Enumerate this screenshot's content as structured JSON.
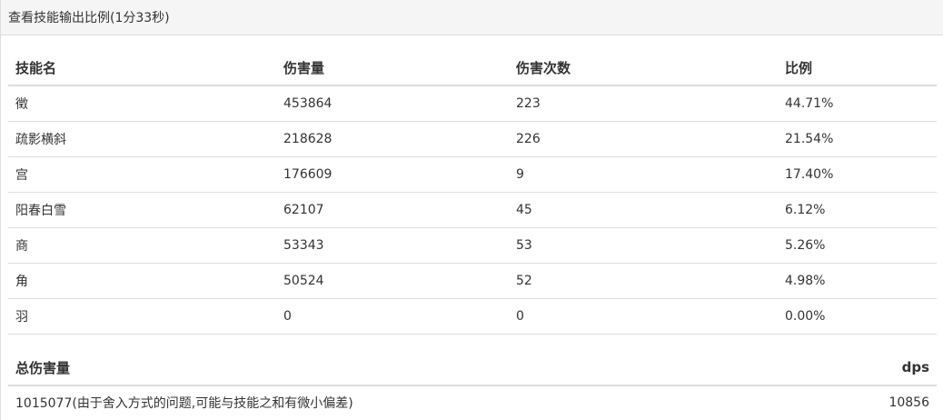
{
  "panel": {
    "title": "查看技能输出比例(1分33秒)"
  },
  "skills_table": {
    "headers": [
      "技能名",
      "伤害量",
      "伤害次数",
      "比例"
    ],
    "rows": [
      [
        "徵",
        "453864",
        "223",
        "44.71%"
      ],
      [
        "疏影横斜",
        "218628",
        "226",
        "21.54%"
      ],
      [
        "宫",
        "176609",
        "9",
        "17.40%"
      ],
      [
        "阳春白雪",
        "62107",
        "45",
        "6.12%"
      ],
      [
        "商",
        "53343",
        "53",
        "5.26%"
      ],
      [
        "角",
        "50524",
        "52",
        "4.98%"
      ],
      [
        "羽",
        "0",
        "0",
        "0.00%"
      ]
    ]
  },
  "totals": {
    "total_label": "总伤害量",
    "dps_label": "dps",
    "total_value": "1015077(由于舍入方式的问题,可能与技能之和有微小偏差)",
    "dps_value": "10856"
  }
}
